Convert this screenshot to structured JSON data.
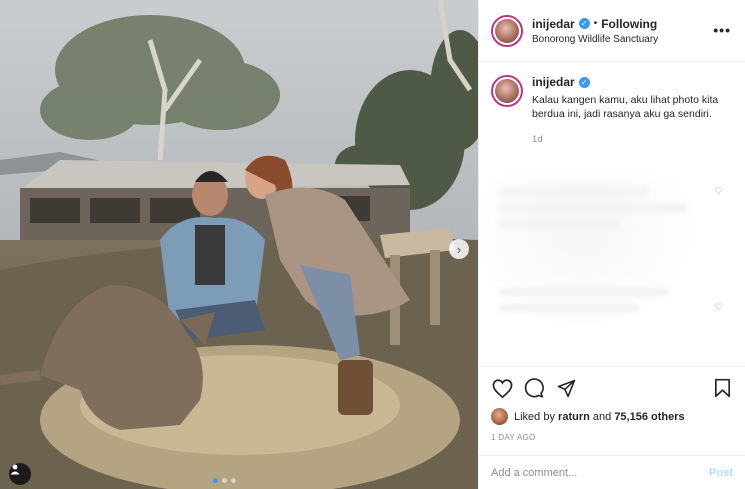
{
  "post": {
    "username": "inijedar",
    "following_label": "Following",
    "location": "Bonorong Wildlife Sanctuary",
    "more_label": "•••",
    "caption": "Kalau kangen kamu, aku lihat photo kita berdua ini, jadi rasanya aku ga sendiri.",
    "caption_time": "1d",
    "liked_by_prefix": "Liked by",
    "liked_by_user": "raturn",
    "liked_by_and": "and",
    "likes_count": "75,156 others",
    "time_ago": "1 DAY AGO"
  },
  "comment_box": {
    "placeholder": "Add a comment...",
    "post_label": "Post"
  },
  "carousel": {
    "current_slide": 1,
    "total_slides": 3
  },
  "colors": {
    "verified": "#3897f0",
    "muted": "#8e8e8e",
    "post_disabled": "#b2dffc"
  }
}
